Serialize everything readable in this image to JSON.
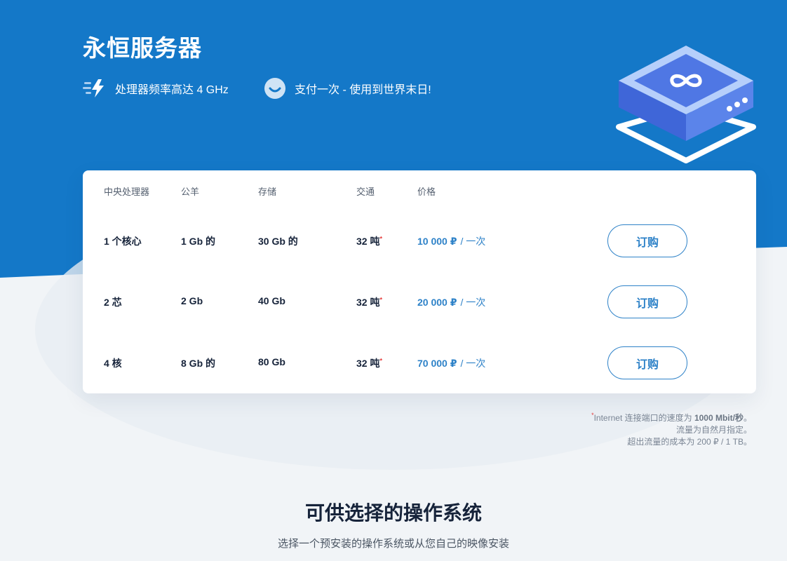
{
  "page": {
    "title": "永恒服务器",
    "features": [
      {
        "icon": "lightning-speed-icon",
        "text": "处理器频率高达 4 GHz"
      },
      {
        "icon": "smile-icon",
        "text": "支付一次 - 使用到世界末日!"
      }
    ],
    "colors": {
      "hero": "#1478c8",
      "accent": "#2e82c8",
      "background": "#f1f4f7"
    }
  },
  "plans": {
    "headers": {
      "cpu": "中央处理器",
      "ram": "公羊",
      "disk": "存储",
      "traffic": "交通",
      "price": "价格"
    },
    "rows": [
      {
        "cpu": "1 个核心",
        "ram": "1 Gb 的",
        "disk": "30 Gb 的",
        "traffic": "32 吨",
        "price": "10 000 ₽",
        "per": "/ 一次",
        "button": "订购"
      },
      {
        "cpu": "2 芯",
        "ram": "2 Gb",
        "disk": "40 Gb",
        "traffic": "32 吨",
        "price": "20 000 ₽",
        "per": "/ 一次",
        "button": "订购"
      },
      {
        "cpu": "4 核",
        "ram": "8 Gb 的",
        "disk": "80 Gb",
        "traffic": "32 吨",
        "price": "70 000 ₽",
        "per": "/ 一次",
        "button": "订购"
      }
    ],
    "footnote_marker": "*"
  },
  "footnote": {
    "line1_prefix": "Internet 连接端口的速度为",
    "line1_bold": "1000 Mbit/秒",
    "line1_suffix": "。",
    "line2": "流量为自然月指定。",
    "line3": "超出流量的成本为 200 ₽ / 1 TB。"
  },
  "os_section": {
    "title": "可供选择的操作系统",
    "subtitle": "选择一个预安装的操作系统或从您自己的映像安装"
  }
}
